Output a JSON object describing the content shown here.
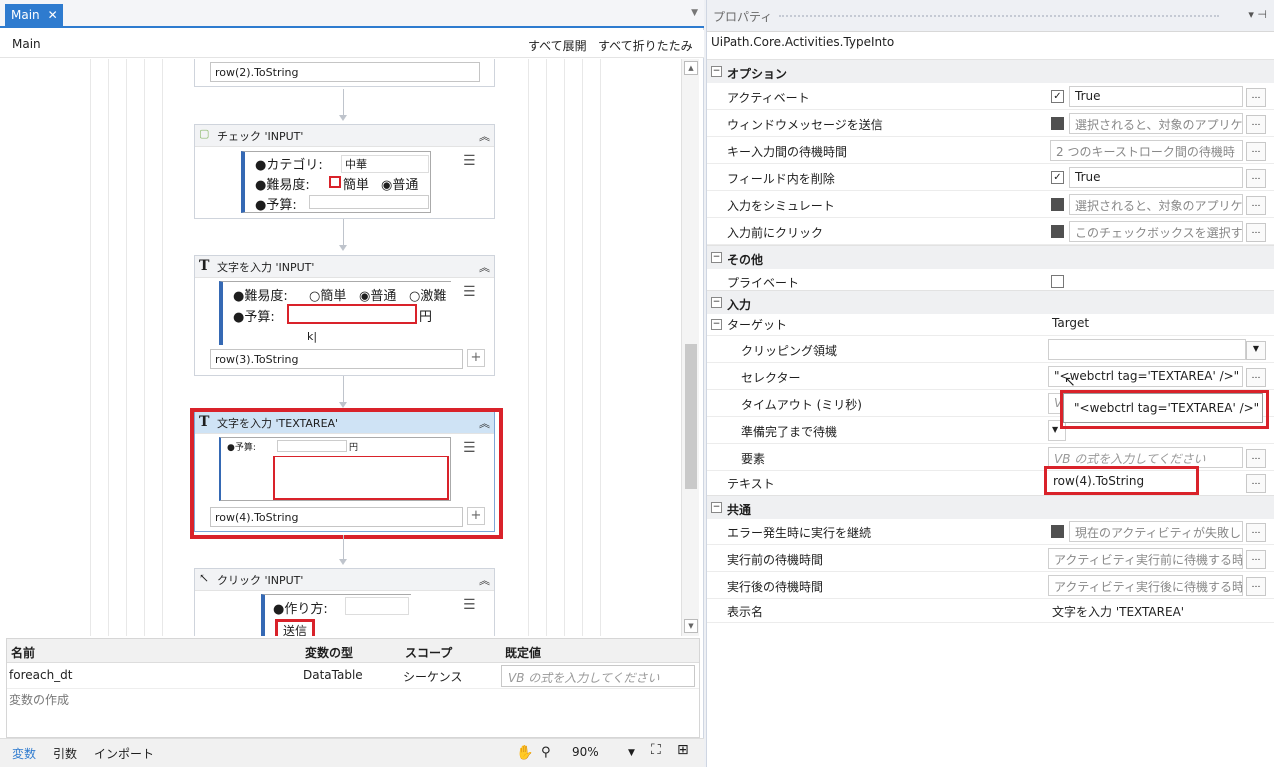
{
  "tab": {
    "label": "Main",
    "close": "✕"
  },
  "designer": {
    "breadcrumb": "Main",
    "expand_all": "すべて展開",
    "collapse_all": "すべて折りたたみ",
    "top_field": "row(2).ToString",
    "check_activity": {
      "title": "チェック 'INPUT'",
      "lines": [
        "●カテゴリ:",
        "中華",
        "●難易度:",
        "簡単",
        "普通",
        "●予算:"
      ]
    },
    "type_input_activity": {
      "title": "文字を入力 'INPUT'",
      "lines": [
        "●難易度:",
        "簡単",
        "普通",
        "激難",
        "●予算:",
        "円"
      ],
      "text_field": "row(3).ToString"
    },
    "type_textarea_activity": {
      "title": "文字を入力 'TEXTAREA'",
      "lines": [
        "●予算:",
        "円"
      ],
      "text_field": "row(4).ToString"
    },
    "click_activity": {
      "title": "クリック 'INPUT'",
      "lines": [
        "●作り方:",
        "送信"
      ]
    }
  },
  "variables": {
    "headers": [
      "名前",
      "変数の型",
      "スコープ",
      "既定値"
    ],
    "rows": [
      {
        "name": "foreach_dt",
        "type": "DataTable",
        "scope": "シーケンス",
        "default_placeholder": "VB の式を入力してください"
      }
    ],
    "create": "変数の作成"
  },
  "bottom_tabs": [
    "変数",
    "引数",
    "インポート"
  ],
  "zoom": "90%",
  "properties": {
    "title": "プロパティ",
    "type_name": "UiPath.Core.Activities.TypeInto",
    "sections": {
      "options": "オプション",
      "misc": "その他",
      "input": "入力",
      "common": "共通"
    },
    "options": [
      {
        "name": "アクティベート",
        "value": "True"
      },
      {
        "name": "ウィンドウメッセージを送信",
        "value": "選択されると、対象のアプリケ"
      },
      {
        "name": "キー入力間の待機時間",
        "value": "2 つのキーストローク間の待機時"
      },
      {
        "name": "フィールド内を削除",
        "value": "True"
      },
      {
        "name": "入力をシミュレート",
        "value": "選択されると、対象のアプリケ"
      },
      {
        "name": "入力前にクリック",
        "value": "このチェックボックスを選択す"
      }
    ],
    "misc": [
      {
        "name": "プライベート"
      }
    ],
    "input": {
      "target_label": "ターゲット",
      "target_value": "Target",
      "clipping": "クリッピング領域",
      "selector": "セレクター",
      "selector_value": "\"<webctrl tag='TEXTAREA' />\"",
      "timeout": "タイムアウト (ミリ秒)",
      "timeout_value": "V",
      "wait_ready": "準備完了まで待機",
      "element": "要素",
      "element_value": "VB の式を入力してください",
      "text": "テキスト",
      "text_value": "row(4).ToString"
    },
    "common": [
      {
        "name": "エラー発生時に実行を継続",
        "value": "現在のアクティビティが失敗し"
      },
      {
        "name": "実行前の待機時間",
        "value": "アクティビティ実行前に待機する時"
      },
      {
        "name": "実行後の待機時間",
        "value": "アクティビティ実行後に待機する時"
      },
      {
        "name": "表示名",
        "value": "文字を入力 'TEXTAREA'"
      }
    ],
    "tooltip": "\"<webctrl tag='TEXTAREA' />\""
  },
  "colors": {
    "accent": "#2e7bcf",
    "highlight": "#d9222a",
    "selected_header": "#cfe3f5"
  }
}
